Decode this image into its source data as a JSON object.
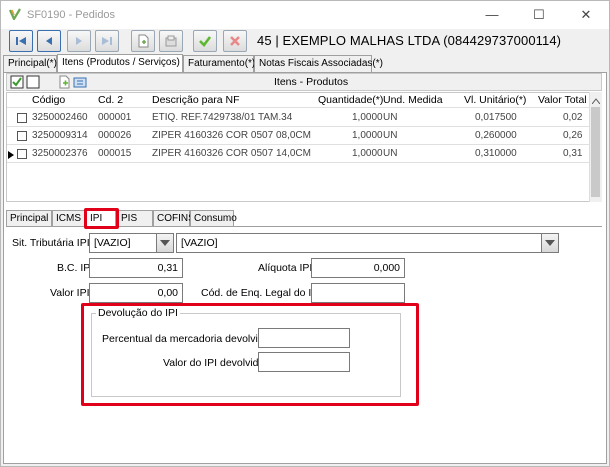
{
  "window": {
    "title": "SF0190 - Pedidos",
    "controls": {
      "minimize": "—",
      "maximize": "☐",
      "close": "✕"
    }
  },
  "toolbar": {
    "record_title": "45 | EXEMPLO MALHAS LTDA (084429737000114)",
    "buttons": [
      "first-record",
      "previous-record",
      "next-record",
      "last-record",
      "new-record",
      "edit-record",
      "confirm",
      "cancel"
    ]
  },
  "main_tabs": [
    "Principal(*)",
    "Itens (Produtos / Serviços)",
    "Faturamento(*)",
    "Notas Fiscais Associadas(*)"
  ],
  "items_grid": {
    "caption": "Itens - Produtos",
    "columns": [
      "Código",
      "Cd. 2",
      "Descrição para NF",
      "Quantidade(*)",
      "Und. Medida",
      "Vl. Unitário(*)",
      "Valor Total"
    ],
    "rows": [
      {
        "codigo": "3250002460",
        "cd2": "000001",
        "descricao": "ETIQ. REF.7429738/01 TAM.34",
        "quantidade": "1,0000",
        "und": "UN",
        "vl_unitario": "0,017500",
        "valor_total": "0,02"
      },
      {
        "codigo": "3250009314",
        "cd2": "000026",
        "descricao": "ZIPER 4160326 COR 0507 08,0CM",
        "quantidade": "1,0000",
        "und": "UN",
        "vl_unitario": "0,260000",
        "valor_total": "0,26"
      },
      {
        "codigo": "3250002376",
        "cd2": "000015",
        "descricao": "ZIPER 4160326 COR 0507 14,0CM",
        "quantidade": "1,0000",
        "und": "UN",
        "vl_unitario": "0,310000",
        "valor_total": "0,31"
      }
    ]
  },
  "sub_tabs": [
    "Principal",
    "ICMS",
    "IPI",
    "PIS",
    "COFINS",
    "Consumo"
  ],
  "ipi": {
    "sit_tributaria_label": "Sit. Tributária IPI",
    "sit_tributaria_code": "[VAZIO]",
    "sit_tributaria_desc": "[VAZIO]",
    "bc_label": "B.C. IPI",
    "bc_value": "0,31",
    "aliquota_label": "Alíquota IPI",
    "aliquota_value": "0,000",
    "valor_label": "Valor IPI",
    "valor_value": "0,00",
    "cod_enq_label": "Cód. de Enq. Legal do IPI",
    "cod_enq_value": "",
    "devolucao": {
      "title": "Devolução do IPI",
      "percentual_label": "Percentual da mercadoria devolvida",
      "percentual_value": "",
      "valor_label": "Valor do IPI devolvido",
      "valor_value": ""
    }
  },
  "colors": {
    "highlight": "#e0001a",
    "toolbar_blue": "#3a6fb0",
    "confirm_green": "#5cb82e",
    "cancel_red": "#d94040"
  }
}
